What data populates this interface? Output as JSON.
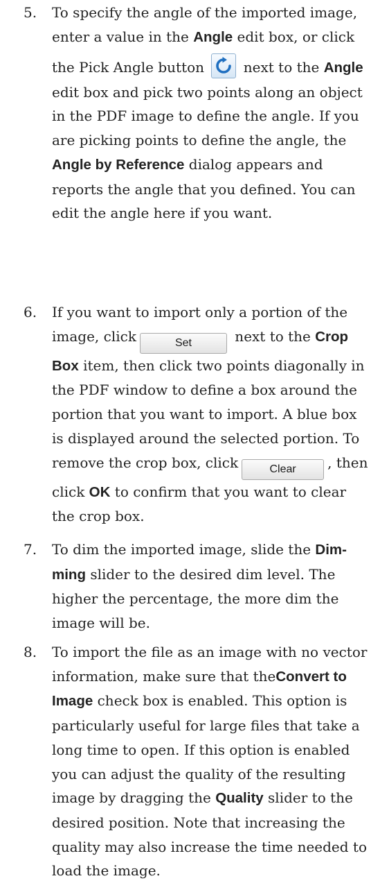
{
  "steps": [
    {
      "number": "5.",
      "line1": "To specify the angle of the imported image, enter a value in the ",
      "b1": "Angle",
      "t2": " edit box, or click",
      "t3": "the Pick Angle button",
      "icon": "rotate-arrow-icon",
      "t4": " next to the ",
      "b2": "Angle",
      "t5": " edit box and pick two points along an object in the PDF image to define the angle. If you are picking points to define the angle, the ",
      "b3": "Angle by Reference",
      "t6": " dialog appears and reports the angle that you defined. You can edit the angle here if you want."
    },
    {
      "number": "6.",
      "t1": "If you want to import only a portion of the image, click",
      "set_button": "Set",
      "t2": " next to the ",
      "b1": "Crop Box",
      "t3": " item, then click two points diagonally in the PDF window to define a box around the por­tion that you want to import. A blue box is displayed around the selected portion. To remove the crop box, click",
      "clear_button": "Clear",
      "t4": ", then click ",
      "b2": "OK",
      "t5": " to confirm that you want to clear the crop box."
    },
    {
      "number": "7.",
      "t1": "To dim the imported image, slide the ",
      "b1": "Dim­ming",
      "t2": " slider to the desired dim level. The higher the percentage, the more dim the image will be."
    },
    {
      "number": "8.",
      "t1": "To import the file as an image with no vector information, make sure that the",
      "b1": "Convert to Image",
      "t2": " check box is enabled. This option is particularly useful for large files that take a long time to open. If this option is enabled you can adjust the quality of the resulting image by dragging the ",
      "b2": "Quality",
      "t3": " slider to the desired position. Note that increasing the quality may also increase the time needed to load the image."
    }
  ],
  "colors": {
    "text": "#222222",
    "icon_blue": "#1f6fc0"
  }
}
